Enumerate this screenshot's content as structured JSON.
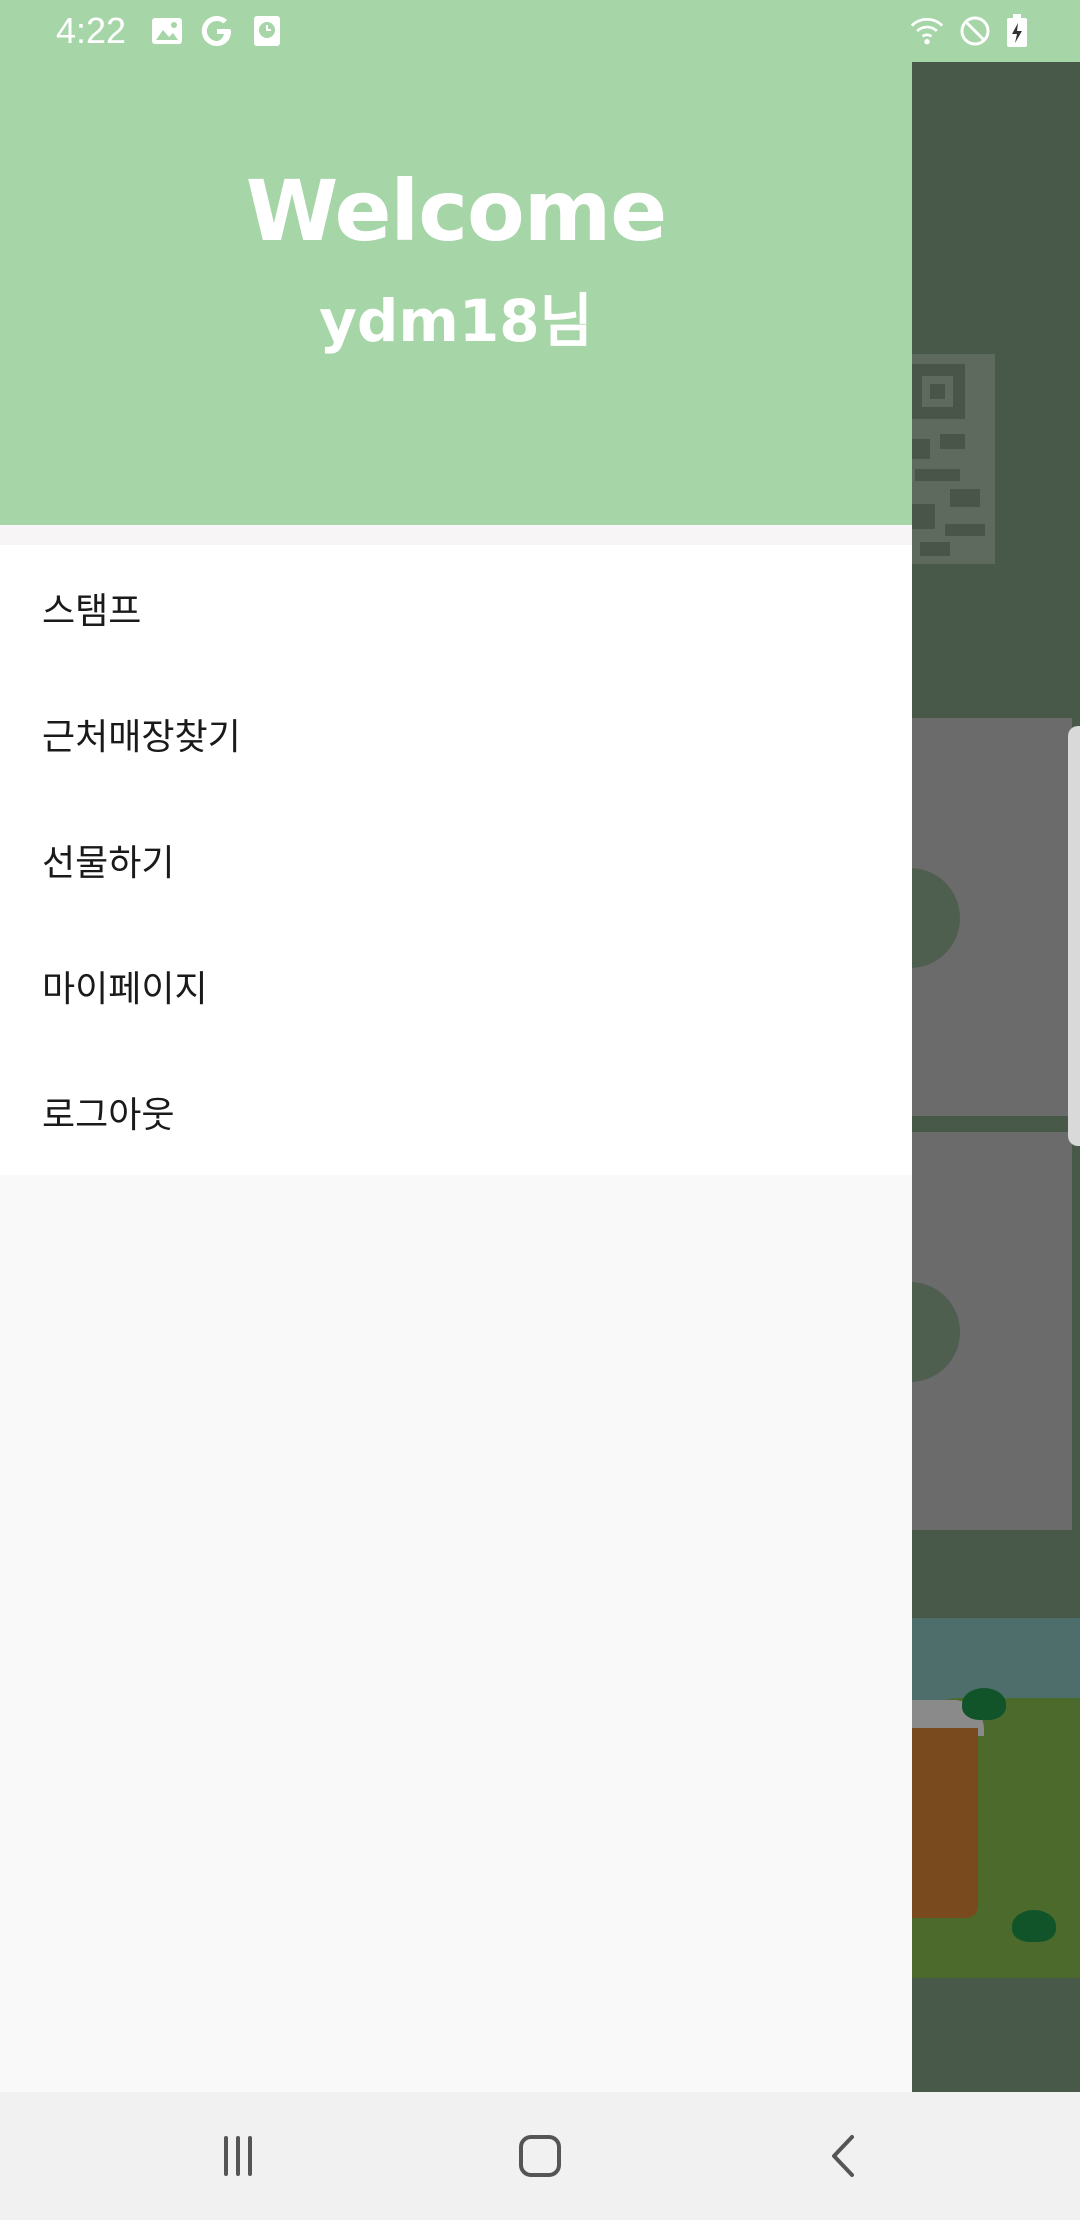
{
  "status_bar": {
    "time": "4:22",
    "left_icons": [
      "image-icon",
      "google-icon",
      "clock-app-icon"
    ],
    "right_icons": [
      "wifi-icon",
      "do-not-disturb-icon",
      "battery-charging-icon"
    ]
  },
  "drawer": {
    "header": {
      "title": "Welcome",
      "user": "ydm18님",
      "color": "#a6d6a7"
    },
    "menu": [
      {
        "label": "스탬프"
      },
      {
        "label": "근처매장찾기"
      },
      {
        "label": "선물하기"
      },
      {
        "label": "마이페이지"
      },
      {
        "label": "로그아웃"
      }
    ]
  },
  "nav_bar": {
    "buttons": [
      "recent-apps-icon",
      "home-icon",
      "back-icon"
    ]
  },
  "colors": {
    "accent": "#a6d6a7",
    "scrim": "#48594a"
  }
}
